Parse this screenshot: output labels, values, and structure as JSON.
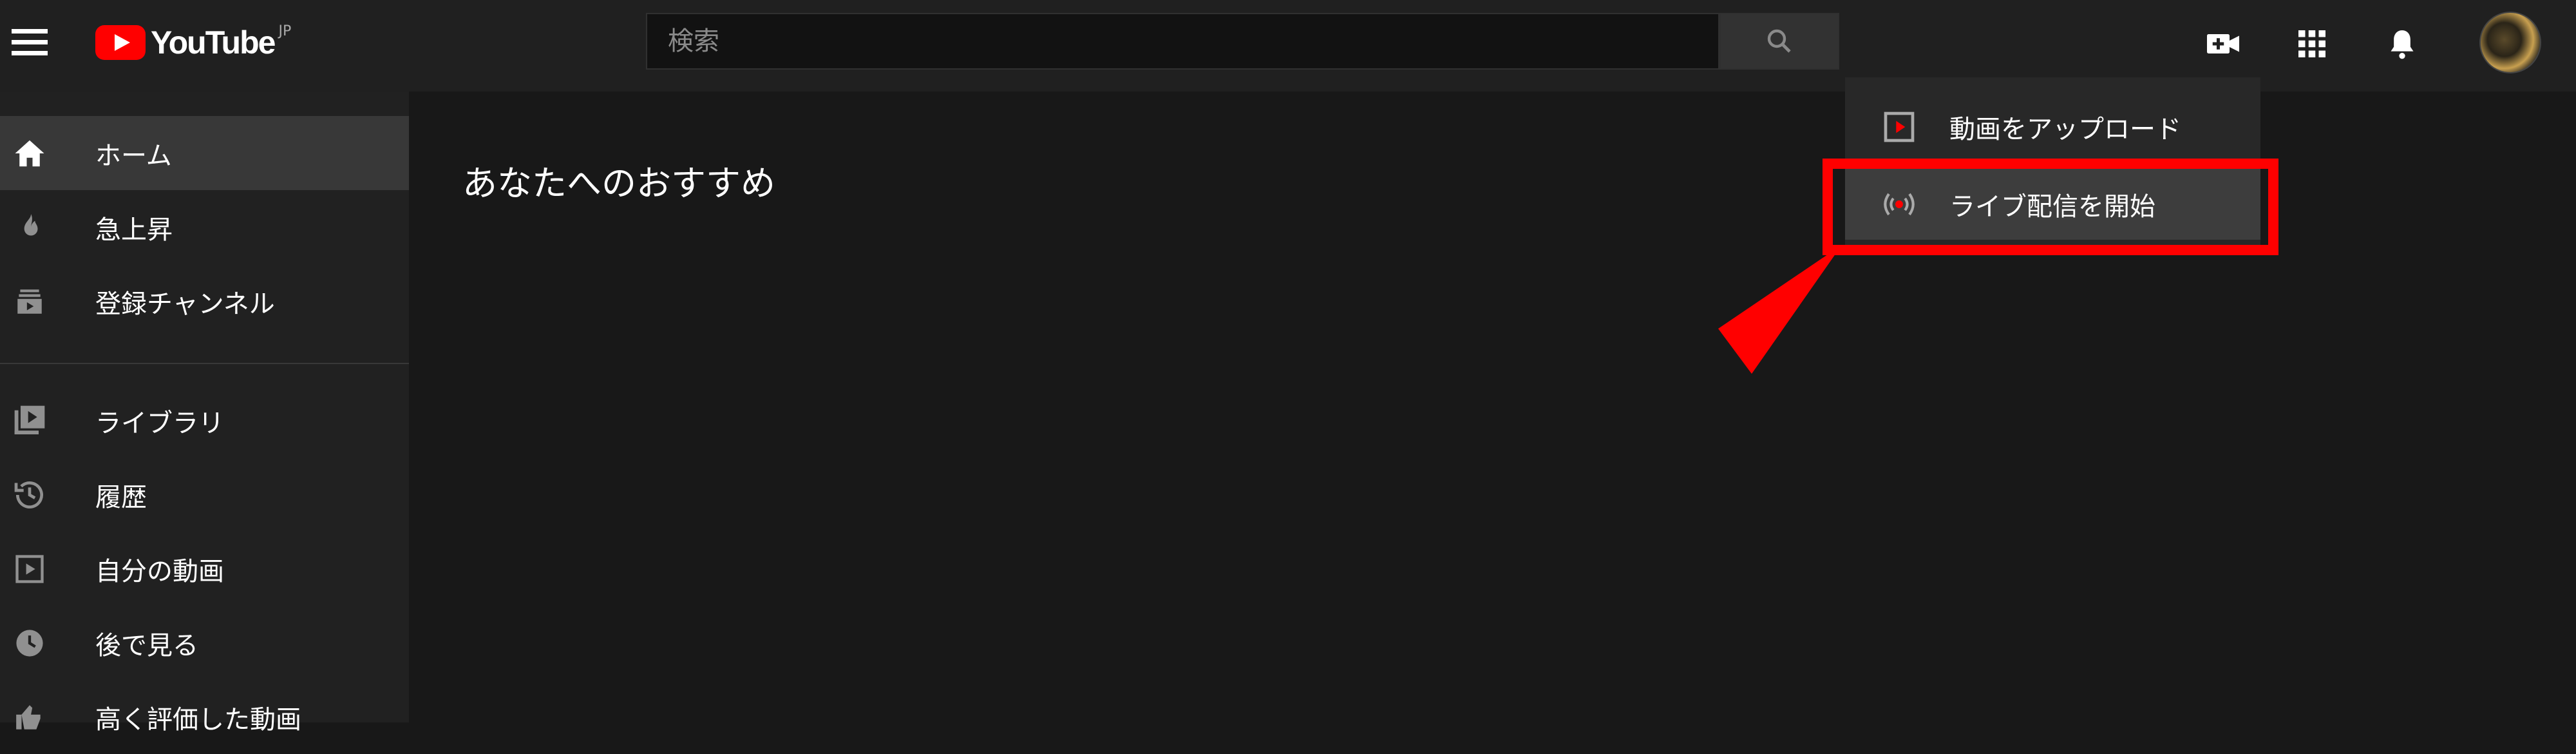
{
  "header": {
    "logo_text": "YouTube",
    "logo_region": "JP",
    "search_placeholder": "検索",
    "icons": [
      "menu-icon",
      "create-video-icon",
      "apps-grid-icon",
      "notifications-bell-icon",
      "account-avatar"
    ]
  },
  "sidebar": {
    "items": [
      {
        "label": "ホーム",
        "icon": "home-icon",
        "active": true
      },
      {
        "label": "急上昇",
        "icon": "trending-fire-icon"
      },
      {
        "label": "登録チャンネル",
        "icon": "subscriptions-icon"
      },
      {
        "label": "ライブラリ",
        "icon": "library-icon"
      },
      {
        "label": "履歴",
        "icon": "history-icon"
      },
      {
        "label": "自分の動画",
        "icon": "your-videos-icon"
      },
      {
        "label": "後で見る",
        "icon": "watch-later-icon"
      },
      {
        "label": "高く評価した動画",
        "icon": "liked-videos-icon"
      }
    ]
  },
  "main": {
    "section_title": "あなたへのおすすめ"
  },
  "create_menu": {
    "items": [
      {
        "label": "動画をアップロード",
        "icon": "upload-video-icon"
      },
      {
        "label": "ライブ配信を開始",
        "icon": "go-live-icon",
        "highlighted": true
      }
    ]
  },
  "colors": {
    "background": "#181818",
    "header": "#202020",
    "sidebar": "#212121",
    "brand_red": "#ff0000",
    "annotation_red": "#ff0000"
  }
}
